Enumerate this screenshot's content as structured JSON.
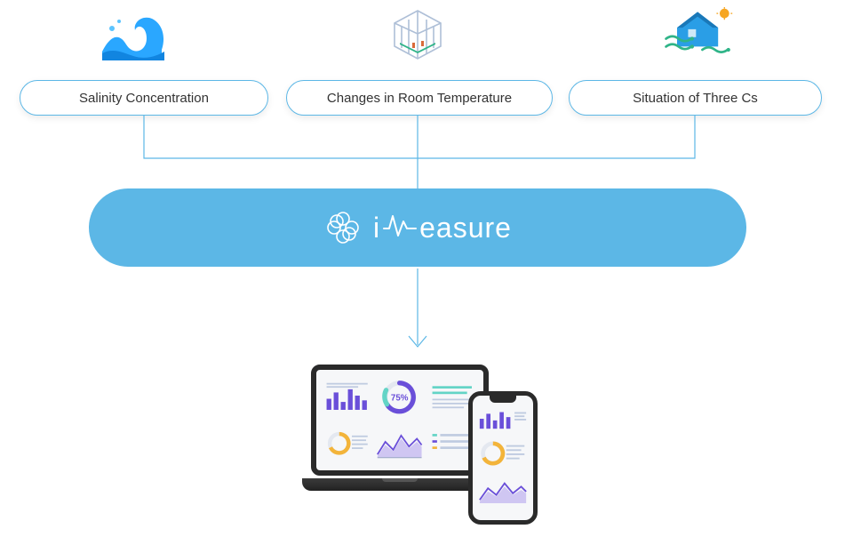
{
  "sources": {
    "salinity": {
      "label": "Salinity Concentration"
    },
    "temperature": {
      "label": "Changes in Room Temperature"
    },
    "threecs": {
      "label": "Situation of Three Cs"
    }
  },
  "brand": {
    "name": "iMeasure",
    "display_prefix": "i",
    "display_suffix": "easure"
  },
  "dashboard": {
    "donut_value": "75%"
  },
  "colors": {
    "accent": "#5cb7e6",
    "wave": "#31a8ff",
    "purple": "#6a4fd9",
    "teal": "#63d4c6",
    "gold": "#f3b43a",
    "green": "#2fb488"
  }
}
